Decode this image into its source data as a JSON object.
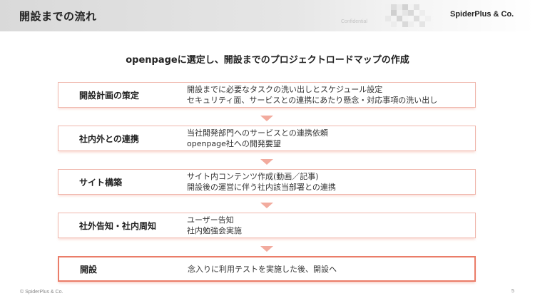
{
  "header": {
    "title": "開設までの流れ",
    "confidential": "Confidential",
    "brand": "SpiderPlus & Co."
  },
  "subtitle": "openpageに選定し、開設までのプロジェクトロードマップの作成",
  "steps": [
    {
      "title": "開設計画の策定",
      "lines": [
        "開設までに必要なタスクの洗い出しとスケジュール設定",
        "セキュリティ面、サービスとの連携にあたり懸念・対応事項の洗い出し"
      ]
    },
    {
      "title": "社内外との連携",
      "lines": [
        "当社開発部門へのサービスとの連携依頼",
        "openpage社への開発要望"
      ]
    },
    {
      "title": "サイト構築",
      "lines": [
        "サイト内コンテンツ作成(動画／記事)",
        "開設後の運営に伴う社内該当部署との連携"
      ]
    },
    {
      "title": "社外告知・社内周知",
      "lines": [
        "ユーザー告知",
        "社内勉強会実施"
      ]
    },
    {
      "title": "開設",
      "lines": [
        "念入りに利用テストを実施した後、開設へ"
      ]
    }
  ],
  "footer": {
    "copyright": "© SpiderPlus & Co.",
    "page_number": "5"
  },
  "colors": {
    "accent_border": "#f0b7ad",
    "accent_strong": "#ea7d69",
    "arrow": "#f2ab9e"
  }
}
